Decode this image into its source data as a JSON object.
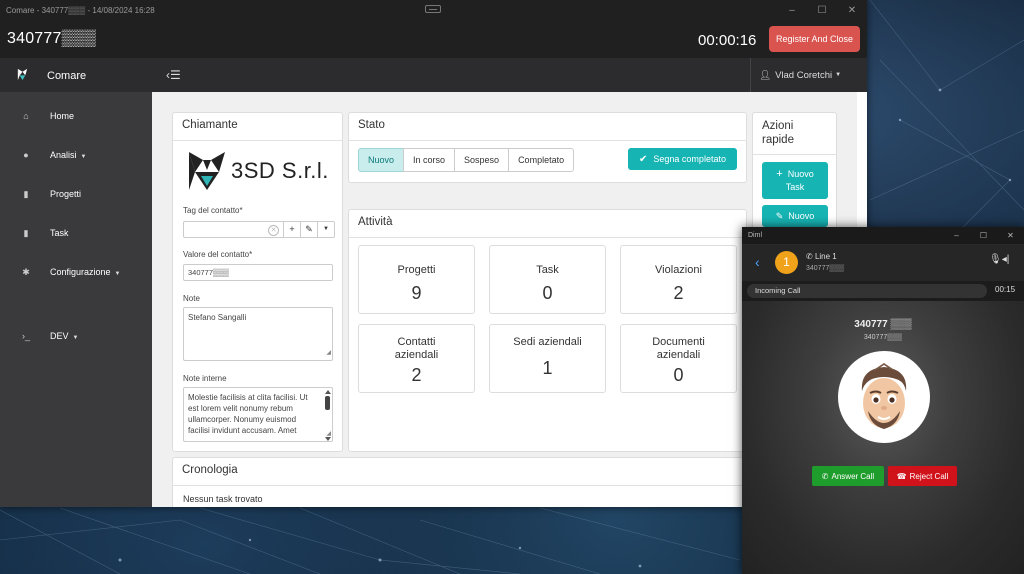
{
  "window": {
    "title": "Comare - 340777▒▒▒ - 14/08/2024 16:28",
    "min_icon": "–",
    "max_icon": "☐",
    "close_icon": "✕"
  },
  "call_header": {
    "caller_number": "340777▒▒▒",
    "timer": "00:00:16",
    "register_label": "Register And Close"
  },
  "app": {
    "brand": "Comare",
    "user": "Vlad Coretchi"
  },
  "sidebar": {
    "items": [
      {
        "label": "Home",
        "icon": "⌂"
      },
      {
        "label": "Analisi",
        "icon": "●"
      },
      {
        "label": "Progetti",
        "icon": "▮"
      },
      {
        "label": "Task",
        "icon": "▮"
      },
      {
        "label": "Configurazione",
        "icon": "✱"
      },
      {
        "label": "DEV",
        "icon": "›_"
      }
    ]
  },
  "chiamante": {
    "title": "Chiamante",
    "company_name": "3SD S.r.l.",
    "tag_label": "Tag del contatto*",
    "tag_value": "",
    "valore_label": "Valore del contatto*",
    "valore_value": "340777▒▒▒",
    "note_label": "Note",
    "note_value": "Stefano Sangalli",
    "note_interne_label": "Note interne",
    "note_interne_value": "Molestie facilisis at clita facilisi. Ut est lorem velit nonumy rebum ullamcorper. Nonumy euismod facilisi invidunt accusam. Amet"
  },
  "stato": {
    "title": "Stato",
    "options": [
      "Nuovo",
      "In corso",
      "Sospeso",
      "Completato"
    ],
    "selected": "Nuovo",
    "complete_label": "Segna completato"
  },
  "azioni": {
    "title_line1": "Azioni",
    "title_line2": "rapide",
    "new_task_line1": "Nuovo",
    "new_task_line2": "Task",
    "new_other": "Nuovo"
  },
  "attivita": {
    "title": "Attività",
    "tiles": [
      {
        "title": "Progetti",
        "value": "9"
      },
      {
        "title": "Task",
        "value": "0"
      },
      {
        "title": "Violazioni",
        "value": "2"
      },
      {
        "title_line1": "Contatti",
        "title_line2": "aziendali",
        "value": "2"
      },
      {
        "title": "Sedi aziendali",
        "value": "1"
      },
      {
        "title_line1": "Documenti",
        "title_line2": "aziendali",
        "value": "0"
      }
    ]
  },
  "cronologia": {
    "title": "Cronologia",
    "empty_text": "Nessun task trovato"
  },
  "softphone": {
    "title": "Diml",
    "line_badge": "1",
    "line_label": "Line 1",
    "line_number": "340777▒▒▒",
    "status": "Incoming Call",
    "call_time": "00:15",
    "caller_number": "340777 ▒▒▒",
    "caller_sub": "340777▒▒▒",
    "answer_label": "Answer Call",
    "reject_label": "Reject Call"
  },
  "colors": {
    "teal": "#17b4b4",
    "danger": "#d9534f",
    "answer": "#1f9d2c",
    "reject": "#d0121b",
    "badge": "#f0a21a"
  }
}
